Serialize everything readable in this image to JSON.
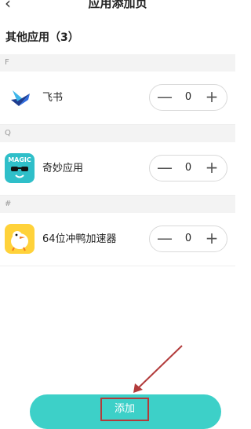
{
  "header": {
    "title": "应用添加页",
    "back_icon": "chevron-left-icon"
  },
  "section": {
    "heading": "其他应用（3）"
  },
  "groups": [
    {
      "letter": "F",
      "app": {
        "name": "飞书",
        "count": "0",
        "icon": "feishu-logo"
      }
    },
    {
      "letter": "Q",
      "app": {
        "name": "奇妙应用",
        "count": "0",
        "icon": "magic-app-logo",
        "icon_text": "MAGIC"
      }
    },
    {
      "letter": "#",
      "app": {
        "name": "64位冲鸭加速器",
        "count": "0",
        "icon": "duck-logo"
      }
    }
  ],
  "stepper": {
    "minus": "—",
    "plus": "+"
  },
  "footer": {
    "add_label": "添加"
  },
  "colors": {
    "accent": "#3dd0c8",
    "annotation": "#b23b3b"
  }
}
